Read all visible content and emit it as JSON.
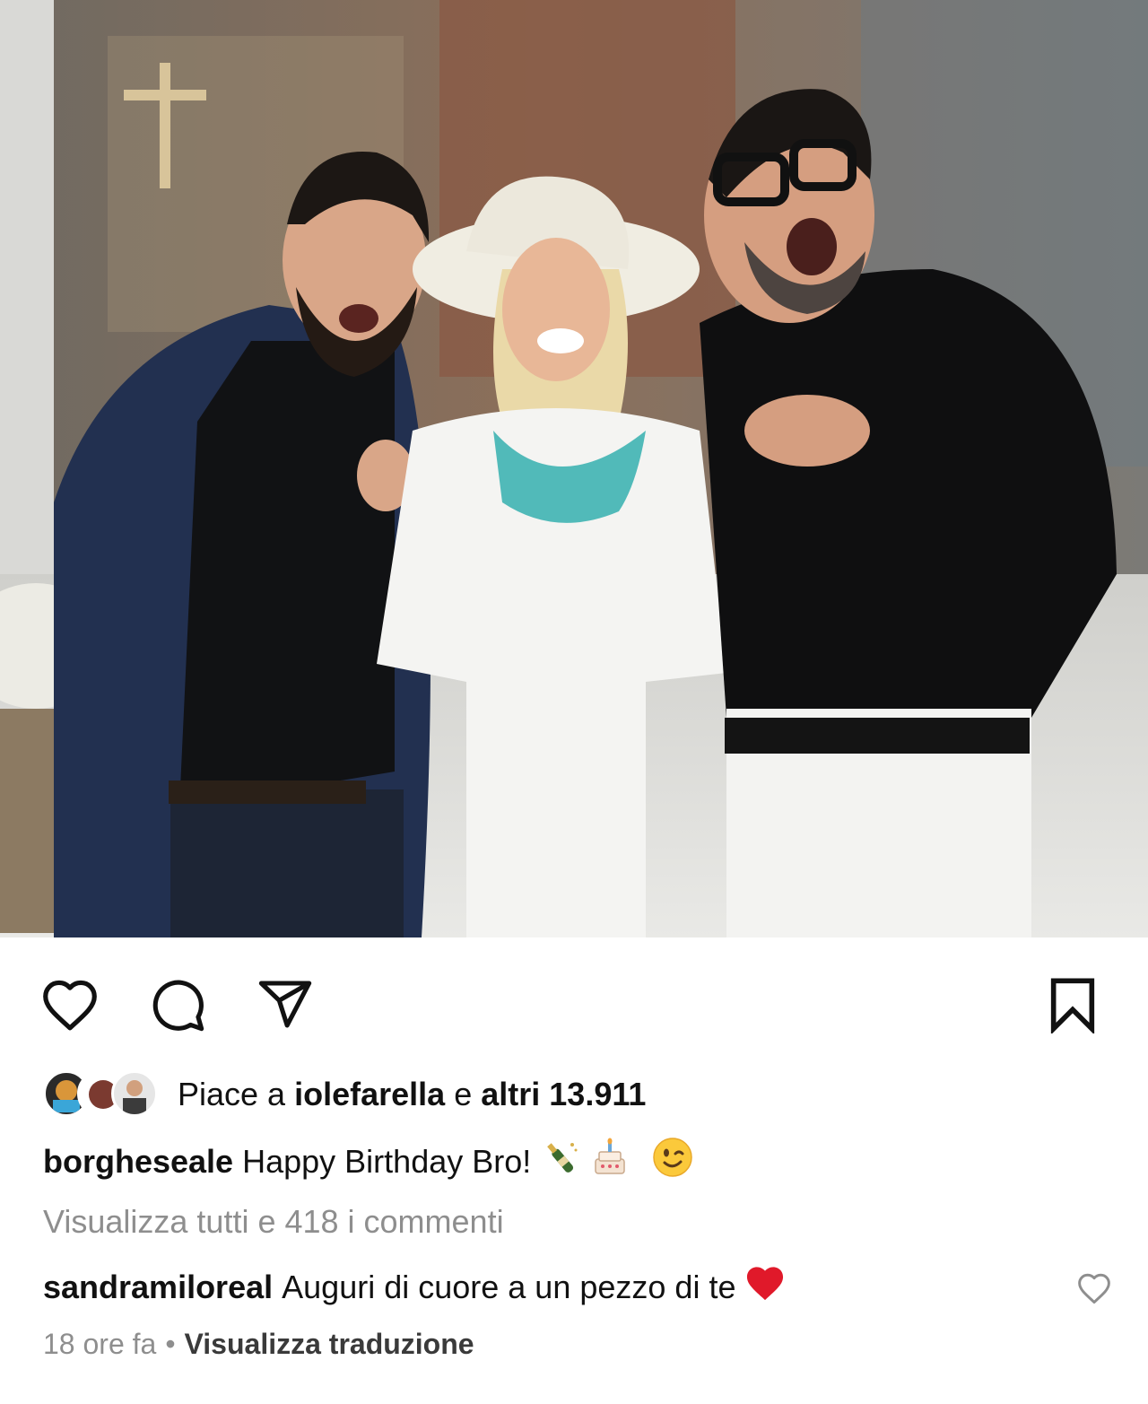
{
  "post": {
    "image_alt": "Three people posing and smiling, two men pointing at a woman in a white hat"
  },
  "actions": {
    "like_icon": "heart-outline-icon",
    "comment_icon": "speech-bubble-icon",
    "share_icon": "paper-plane-icon",
    "save_icon": "bookmark-outline-icon"
  },
  "likes": {
    "prefix": "Piace a",
    "user": "iolefarella",
    "middle": "e",
    "others": "altri 13.911"
  },
  "caption": {
    "username": "borgheseale",
    "text": "Happy Birthday Bro!"
  },
  "view_all_comments": "Visualizza tutti e 418 i commenti",
  "comment": {
    "username": "sandramiloreal",
    "text": "Auguri di cuore a un pezzo di te"
  },
  "meta": {
    "time": "18 ore fa",
    "separator": "•",
    "translate": "Visualizza traduzione"
  },
  "colors": {
    "text": "#111111",
    "muted": "#8e8e8e",
    "heart_red": "#e0192a"
  }
}
